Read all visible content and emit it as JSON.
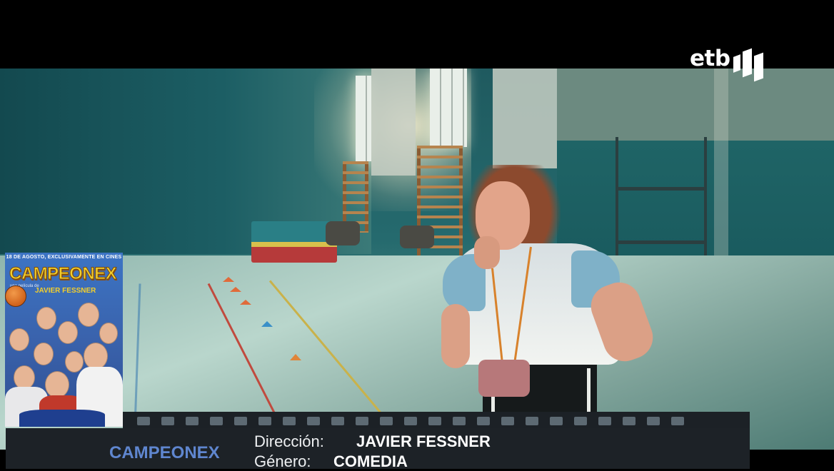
{
  "channel_logo": {
    "text": "etb"
  },
  "poster": {
    "date_line": "18 DE AGOSTO, EXCLUSIVAMENTE EN CINES",
    "title": "CAMPEONEX",
    "subtitle": "una película de",
    "director": "JAVIER FESSNER"
  },
  "info": {
    "title": "CAMPEONEX",
    "direction_label": "Dirección:",
    "direction_value": "JAVIER FESSNER",
    "genre_label": "Género:",
    "genre_value": "COMEDIA"
  },
  "colors": {
    "info_title": "#5f86cf",
    "infobar_bg": "#1d2227",
    "poster_title": "#f3cf2c"
  }
}
